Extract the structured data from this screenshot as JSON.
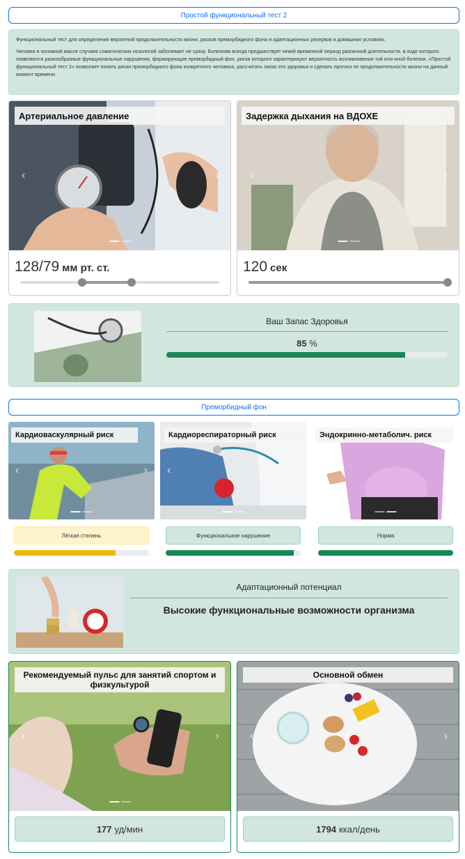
{
  "header": {
    "title": "Простой функциональный тест 2"
  },
  "intro": {
    "p1": "Функциональный тест для определения вероятной продолжительности жизни, рисков преморбидного фона и адаптационных резервов в домашних условиях.",
    "p2": "Человек в основной массе случаев соматических нозологий заболевает не сразу. Болезням всегда предшествует некий временной период различной длительности, в ходе которого появляются разнообразные функциональные нарушения, формирующие преморбидный фон, риски которого характеризуют вероятность возникновения той или иной болезни. «Простой функциональный тест 2» позволяет понять риски преморбидного фона конкретного человека, рассчитать запас его здоровья и сделать прогноз по продолжительности жизни на данный момент времени."
  },
  "blood_pressure": {
    "caption": "Артериальное давление",
    "value": "128/79",
    "unit": "мм рт. ст.",
    "slider_low": 0.31,
    "slider_high": 0.56
  },
  "breath_hold": {
    "caption": "Задержка дыхания на ВДОХЕ",
    "value": "120",
    "unit": "сек",
    "slider": 1.0
  },
  "health_reserve": {
    "title": "Ваш Запас Здоровья",
    "value": "85",
    "unit": "%",
    "percent": 85
  },
  "premorbid": {
    "title": "Преморбидный фон"
  },
  "risks": [
    {
      "caption": "Кардиоваскулярный риск",
      "status": "Лёгкая степень",
      "percent": 75,
      "color": "#f0b80f"
    },
    {
      "caption": "Кардиореспираторный риск",
      "status": "Функциональное нарушение",
      "percent": 95,
      "color": "#198754"
    },
    {
      "caption": "Эндокринно-метаболич. риск",
      "status": "Норма",
      "percent": 100,
      "color": "#198754"
    }
  ],
  "adaptation": {
    "title": "Адаптационный потенциал",
    "value": "Высокие функциональные возможности организма"
  },
  "pulse": {
    "caption": "Рекомендуемый пульс для занятий спортом и физкультурой",
    "value": "177",
    "unit": "уд/мин"
  },
  "metabolism": {
    "caption": "Основной обмен",
    "value": "1794",
    "unit": "ккал/день"
  },
  "colors": {
    "accent": "#0d6efd",
    "panel": "#d1e7dd",
    "success": "#198754",
    "warning": "#f0b80f"
  }
}
